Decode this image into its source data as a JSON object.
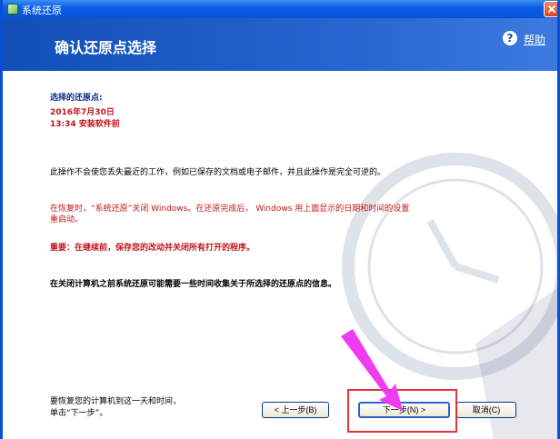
{
  "window": {
    "title": "系统还原",
    "heading": "确认还原点选择",
    "help_label": "帮助"
  },
  "restore_point": {
    "label": "选择的还原点:",
    "date": "2016年7月30日",
    "time_desc": "13:34 安装软件前"
  },
  "body": {
    "info": "此操作不会使您丢失最近的工作，例如已保存的文档或电子邮件，并且此操作是完全可逆的。",
    "warning_line1": "在恢复时，“系统还原”关闭 Windows。在还原完成后， Windows 用上面显示的日期和时间的设置",
    "warning_line2": "重启动。",
    "important": "重要：在继续前，保存您的改动并关闭所有打开的程序。",
    "note": "在关闭计算机之前系统还原可能需要一些时间收集关于所选择的还原点的信息。",
    "footer_line1": "要恢复您的计算机到这一天和时间，",
    "footer_line2": "单击“下一步”。"
  },
  "buttons": {
    "back": "< 上一步(B)",
    "next": "下一步(N) >",
    "cancel": "取消(C)"
  },
  "icons": {
    "help": "question-circle-icon",
    "app": "system-restore-icon",
    "close": "close-icon",
    "watermark": "clock-watermark-icon",
    "pointer": "magenta-arrow-icon"
  },
  "colors": {
    "titlebar": "#0a5fe6",
    "banner": "#124fb8",
    "warning_red": "#c0141a",
    "label_navy": "#0b2a8a",
    "highlight_red": "#e8323a",
    "arrow_magenta": "#f03cf0"
  }
}
